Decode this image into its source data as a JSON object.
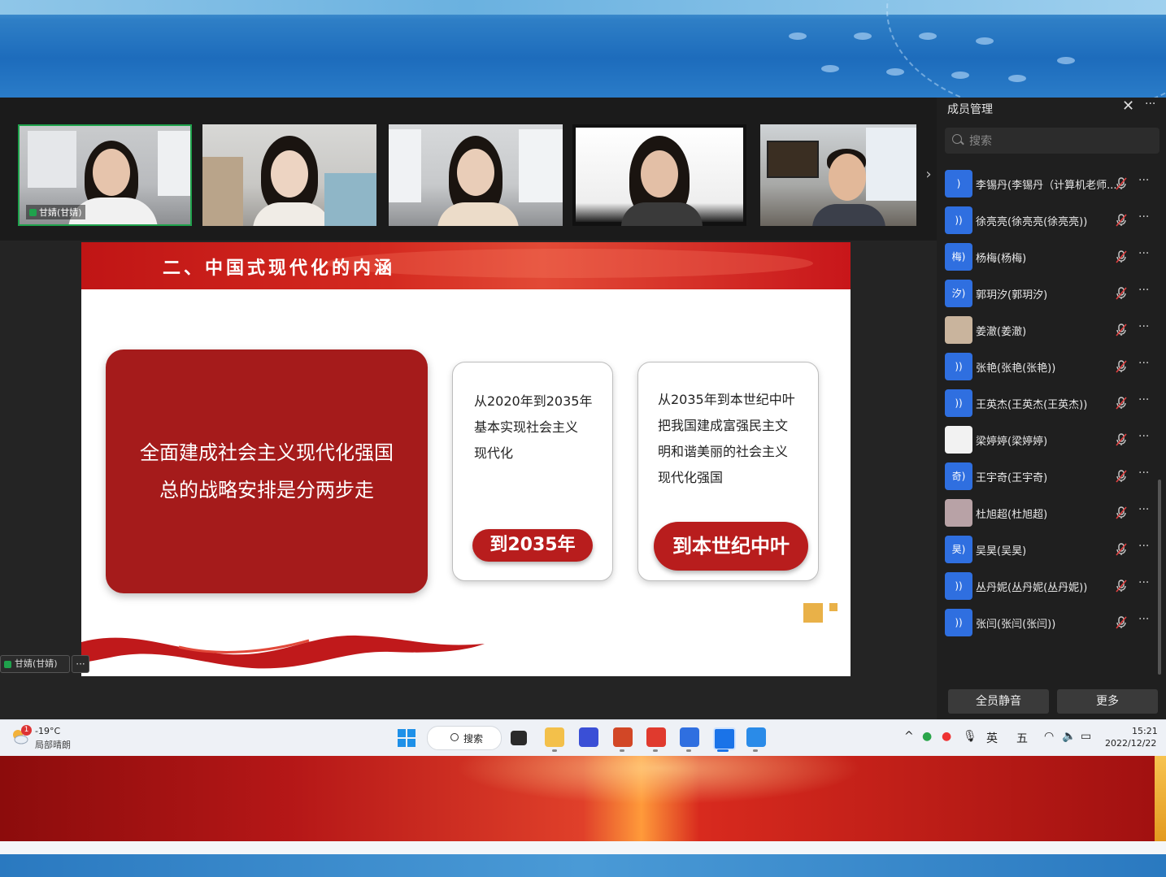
{
  "video_tiles": [
    {
      "label": "甘婧(甘婧)"
    },
    {
      "label": ""
    },
    {
      "label": ""
    },
    {
      "label": ""
    },
    {
      "label": ""
    }
  ],
  "slide": {
    "title": "二、中国式现代化的内涵",
    "main_card": {
      "line1": "全面建成社会主义现代化强国",
      "line2": "总的战略安排是分两步走"
    },
    "step1": {
      "lines": [
        "从2020年到2035年",
        "基本实现社会主义",
        "现代化"
      ],
      "button": "到2035年"
    },
    "step2": {
      "lines": [
        "从2035年到本世纪中叶",
        "把我国建成富强民主文",
        "明和谐美丽的社会主义",
        "现代化强国"
      ],
      "button": "到本世纪中叶"
    }
  },
  "self_tag": {
    "name": "甘婧(甘婧)",
    "more": "···"
  },
  "panel": {
    "title": "成员管理",
    "close_icon": "close-icon",
    "more": "···",
    "search_placeholder": "搜索",
    "members": [
      {
        "avatar": ")",
        "name": "李锡丹(李锡丹（计算机老师...",
        "avatar_type": "speaking"
      },
      {
        "avatar": "))",
        "name": "徐亮亮(徐亮亮(徐亮亮))",
        "avatar_type": "speaking"
      },
      {
        "avatar": "梅)",
        "name": "杨梅(杨梅)",
        "avatar_type": "text"
      },
      {
        "avatar": "汐)",
        "name": "郭玥汐(郭玥汐)",
        "avatar_type": "text"
      },
      {
        "avatar": "",
        "name": "姜澈(姜澈)",
        "avatar_type": "photo"
      },
      {
        "avatar": "))",
        "name": "张艳(张艳(张艳))",
        "avatar_type": "speaking"
      },
      {
        "avatar": "))",
        "name": "王英杰(王英杰(王英杰))",
        "avatar_type": "speaking"
      },
      {
        "avatar": "",
        "name": "梁婷婷(梁婷婷)",
        "avatar_type": "photo"
      },
      {
        "avatar": "奇)",
        "name": "王宇奇(王宇奇)",
        "avatar_type": "text"
      },
      {
        "avatar": "",
        "name": "杜旭超(杜旭超)",
        "avatar_type": "photo"
      },
      {
        "avatar": "昊)",
        "name": "吴昊(吴昊)",
        "avatar_type": "text"
      },
      {
        "avatar": "))",
        "name": "丛丹妮(丛丹妮(丛丹妮))",
        "avatar_type": "speaking"
      },
      {
        "avatar": "))",
        "name": "张闫(张闫(张闫))",
        "avatar_type": "speaking"
      }
    ],
    "mute_all": "全员静音",
    "more_button": "更多"
  },
  "taskbar": {
    "weather_badge": "1",
    "temperature": "-19°C",
    "weather": "局部晴朗",
    "search": "搜索",
    "ime_lang": "英",
    "ime_mode": "五",
    "time": "15:21",
    "date": "2022/12/22"
  },
  "colors": {
    "slide_red": "#a51b1b",
    "button_red": "#b81d1d",
    "accent_gold": "#e9b148",
    "avatar_blue": "#2f6fe0"
  }
}
